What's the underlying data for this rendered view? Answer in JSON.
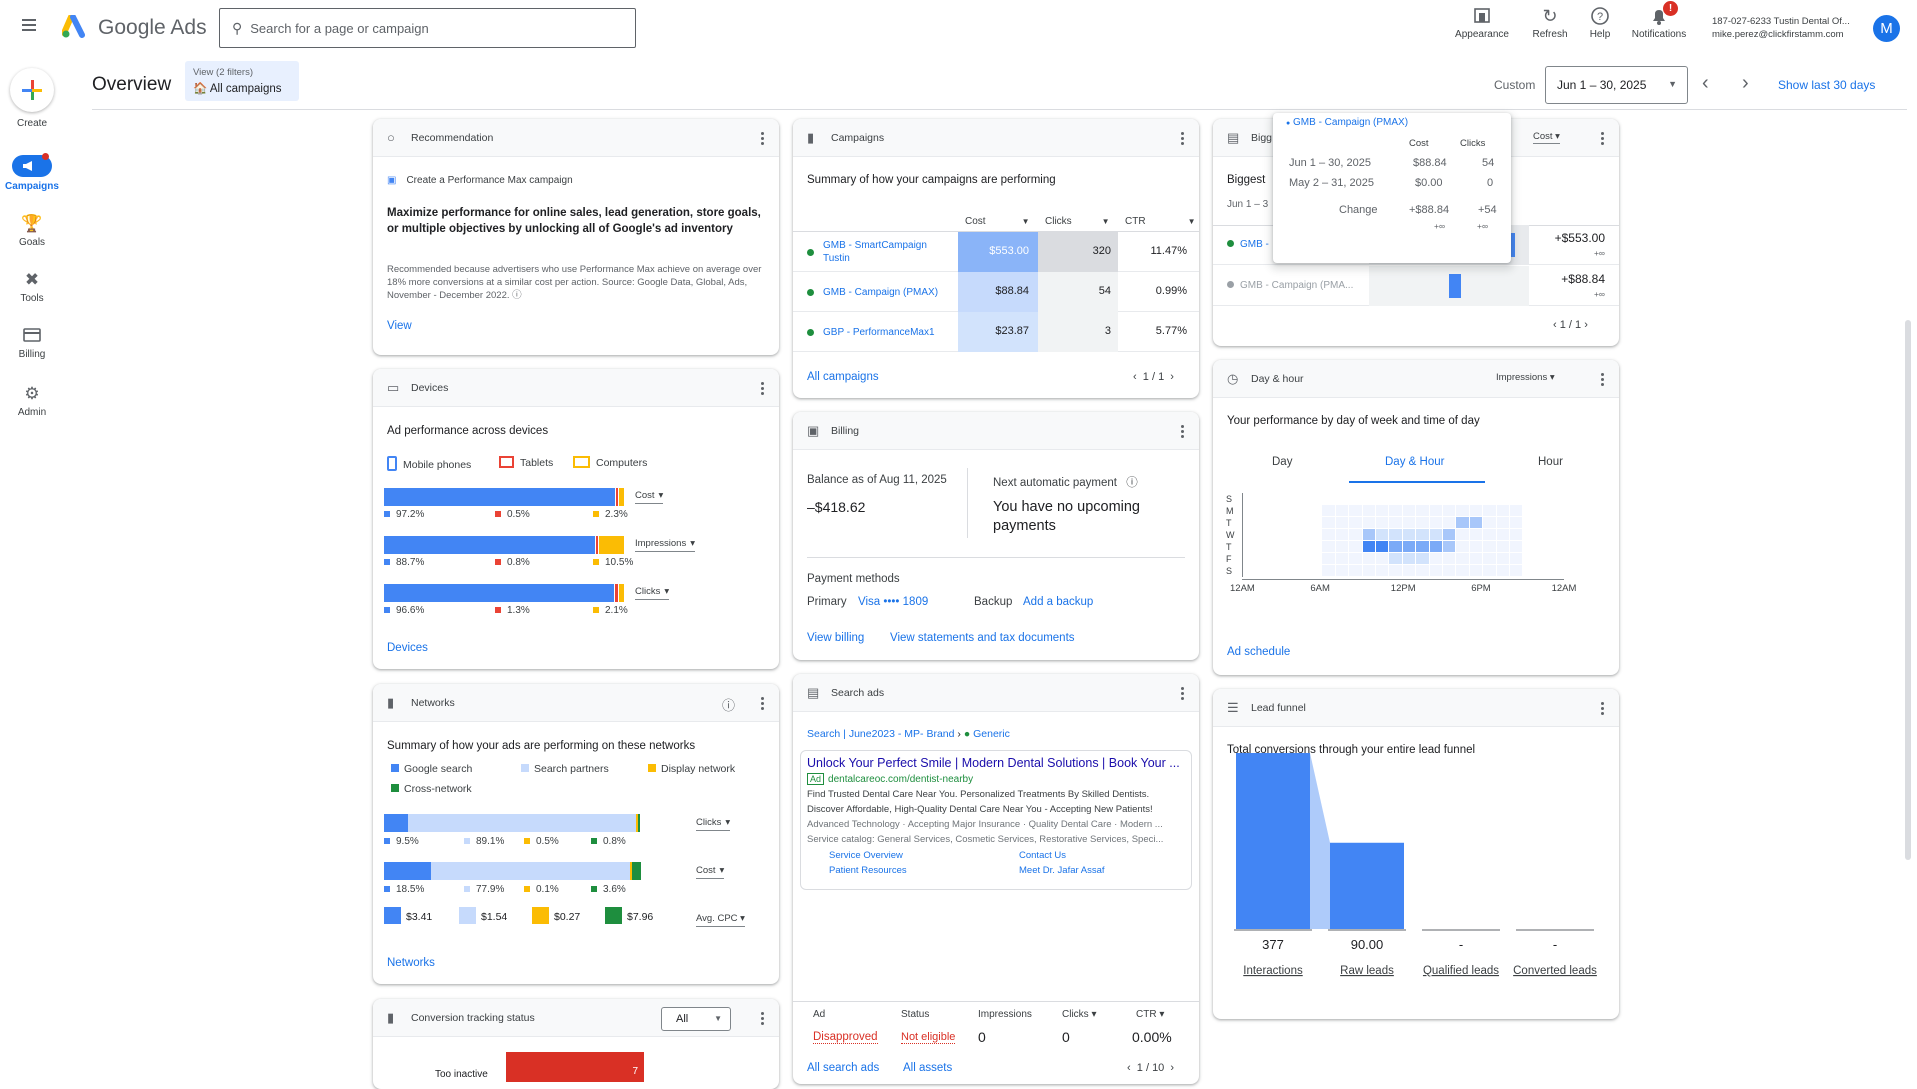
{
  "app": {
    "name": "Google Ads",
    "search_placeholder": "Search for a page or campaign"
  },
  "topbar": {
    "appearance": "Appearance",
    "refresh": "Refresh",
    "help": "Help",
    "notifications": "Notifications",
    "notif_badge": "!",
    "account_line1": "187-027-6233 Tustin Dental Of...",
    "account_line2": "mike.perez@clickfirstamm.com",
    "avatar": "M"
  },
  "nav": {
    "create": "Create",
    "campaigns": "Campaigns",
    "goals": "Goals",
    "tools": "Tools",
    "billing": "Billing",
    "admin": "Admin"
  },
  "header": {
    "title": "Overview",
    "view_filters": "View (2 filters)",
    "view_value": "All campaigns",
    "custom": "Custom",
    "date_range": "Jun 1 – 30, 2025",
    "show_last": "Show last 30 days"
  },
  "recommendation": {
    "title": "Recommendation",
    "item": "Create a Performance Max campaign",
    "headline": "Maximize performance for online sales, lead generation, store goals, or multiple objectives by unlocking all of Google's ad inventory",
    "body": "Recommended because advertisers who use Performance Max achieve on average over 18% more conversions at a similar cost per action. Source: Google Data, Global, Ads, November - December 2022.",
    "link": "View"
  },
  "campaigns": {
    "title": "Campaigns",
    "subtitle": "Summary of how your campaigns are performing",
    "columns": [
      "Cost",
      "Clicks",
      "CTR"
    ],
    "rows": [
      {
        "name": "GMB - SmartCampaign Tustin",
        "cost": "$553.00",
        "clicks": "320",
        "ctr": "11.47%"
      },
      {
        "name": "GMB - Campaign (PMAX)",
        "cost": "$88.84",
        "clicks": "54",
        "ctr": "0.99%"
      },
      {
        "name": "GBP - PerformanceMax1",
        "cost": "$23.87",
        "clicks": "3",
        "ctr": "5.77%"
      }
    ],
    "link": "All campaigns",
    "pager": "1 / 1"
  },
  "biggest": {
    "title": "Bigg",
    "dropdown": "Cost",
    "subtitle": "Biggest",
    "date": "Jun 1 – 3",
    "rows": [
      {
        "name": "GMB -",
        "value": "+$553.00",
        "sub": "+∞"
      },
      {
        "name": "GMB - Campaign (PMA...",
        "value": "+$88.84",
        "sub": "+∞"
      }
    ],
    "pager": "1 / 1"
  },
  "tooltip": {
    "title": "GMB - Campaign (PMAX)",
    "col1": "Cost",
    "col2": "Clicks",
    "r1_label": "Jun 1 – 30, 2025",
    "r1_cost": "$88.84",
    "r1_clicks": "54",
    "r2_label": "May 2 – 31, 2025",
    "r2_cost": "$0.00",
    "r2_clicks": "0",
    "change_label": "Change",
    "change_cost": "+$88.84",
    "change_clicks": "+54",
    "inf1": "+∞",
    "inf2": "+∞"
  },
  "devices": {
    "title": "Devices",
    "subtitle": "Ad performance across devices",
    "legend": [
      "Mobile phones",
      "Tablets",
      "Computers"
    ],
    "metrics": [
      {
        "label": "Cost",
        "values": [
          "97.2%",
          "0.5%",
          "2.3%"
        ],
        "fracs": [
          0.972,
          0.005,
          0.023
        ]
      },
      {
        "label": "Impressions",
        "values": [
          "88.7%",
          "0.8%",
          "10.5%"
        ],
        "fracs": [
          0.887,
          0.008,
          0.105
        ]
      },
      {
        "label": "Clicks",
        "values": [
          "96.6%",
          "1.3%",
          "2.1%"
        ],
        "fracs": [
          0.966,
          0.013,
          0.021
        ]
      }
    ],
    "link": "Devices"
  },
  "billing": {
    "title": "Billing",
    "balance_label": "Balance as of Aug 11, 2025",
    "balance": "–$418.62",
    "next_label": "Next automatic payment",
    "next_value": "You have no upcoming payments",
    "methods": "Payment methods",
    "primary": "Primary",
    "card": "Visa •••• 1809",
    "backup": "Backup",
    "add_backup": "Add a backup",
    "view_billing": "View billing",
    "statements": "View statements and tax documents"
  },
  "dayhour": {
    "title": "Day & hour",
    "dropdown": "Impressions",
    "subtitle": "Your performance by day of week and time of day",
    "tabs": [
      "Day",
      "Day & Hour",
      "Hour"
    ],
    "days": [
      "S",
      "M",
      "T",
      "W",
      "T",
      "F",
      "S"
    ],
    "hours": [
      "12AM",
      "6AM",
      "12PM",
      "6PM",
      "12AM"
    ],
    "link": "Ad schedule"
  },
  "networks": {
    "title": "Networks",
    "subtitle": "Summary of how your ads are performing on these networks",
    "legend": [
      "Google search",
      "Search partners",
      "Display network",
      "Cross-network"
    ],
    "metrics": [
      {
        "label": "Clicks",
        "values": [
          "9.5%",
          "89.1%",
          "0.5%",
          "0.8%"
        ],
        "fracs": [
          0.095,
          0.891,
          0.005,
          0.008
        ]
      },
      {
        "label": "Cost",
        "values": [
          "18.5%",
          "77.9%",
          "0.1%",
          "3.6%"
        ],
        "fracs": [
          0.185,
          0.779,
          0.001,
          0.036
        ]
      }
    ],
    "cpc": {
      "label": "Avg. CPC",
      "values": [
        "$3.41",
        "$1.54",
        "$0.27",
        "$7.96"
      ]
    },
    "link": "Networks"
  },
  "searchads": {
    "title": "Search ads",
    "crumb1": "Search | June2023 - MP- Brand",
    "crumb2": "Generic",
    "ad_title": "Unlock Your Perfect Smile | Modern Dental Solutions | Book Your ...",
    "ad_badge": "Ad",
    "ad_url": "dentalcareoc.com/dentist-nearby",
    "desc1": "Find Trusted Dental Care Near You. Personalized Treatments By Skilled Dentists.",
    "desc2": "Discover Affordable, High-Quality Dental Care Near You - Accepting New Patients!",
    "callouts": "Advanced Technology · Accepting Major Insurance · Quality Dental Care · Modern ...",
    "catalog": "Service catalog: General Services, Cosmetic Services, Restorative Services, Speci...",
    "sitelinks": [
      "Service Overview",
      "Contact Us",
      "Patient Resources",
      "Meet Dr. Jafar Assaf"
    ],
    "cols": [
      "Ad",
      "Status",
      "Impressions",
      "Clicks",
      "CTR"
    ],
    "ad_status": "Disapproved",
    "status": "Not eligible",
    "impressions": "0",
    "clicks": "0",
    "ctr": "0.00%",
    "link1": "All search ads",
    "link2": "All assets",
    "pager": "1 / 10"
  },
  "leadfunnel": {
    "title": "Lead funnel",
    "subtitle": "Total conversions through your entire lead funnel",
    "values": [
      "377",
      "90.00",
      "-",
      "-"
    ],
    "labels": [
      "Interactions",
      "Raw leads",
      "Qualified leads",
      "Converted leads"
    ],
    "fracs": [
      1.0,
      0.49,
      0,
      0
    ]
  },
  "conversion": {
    "title": "Conversion tracking status",
    "dropdown": "All",
    "bar_label": "Too inactive",
    "bar_value": "7"
  },
  "colors": {
    "blue": "#4285f4",
    "red": "#ea4335",
    "yellow": "#fbbc04",
    "green": "#1e8e3e",
    "lightblue": "#c6dafc"
  }
}
